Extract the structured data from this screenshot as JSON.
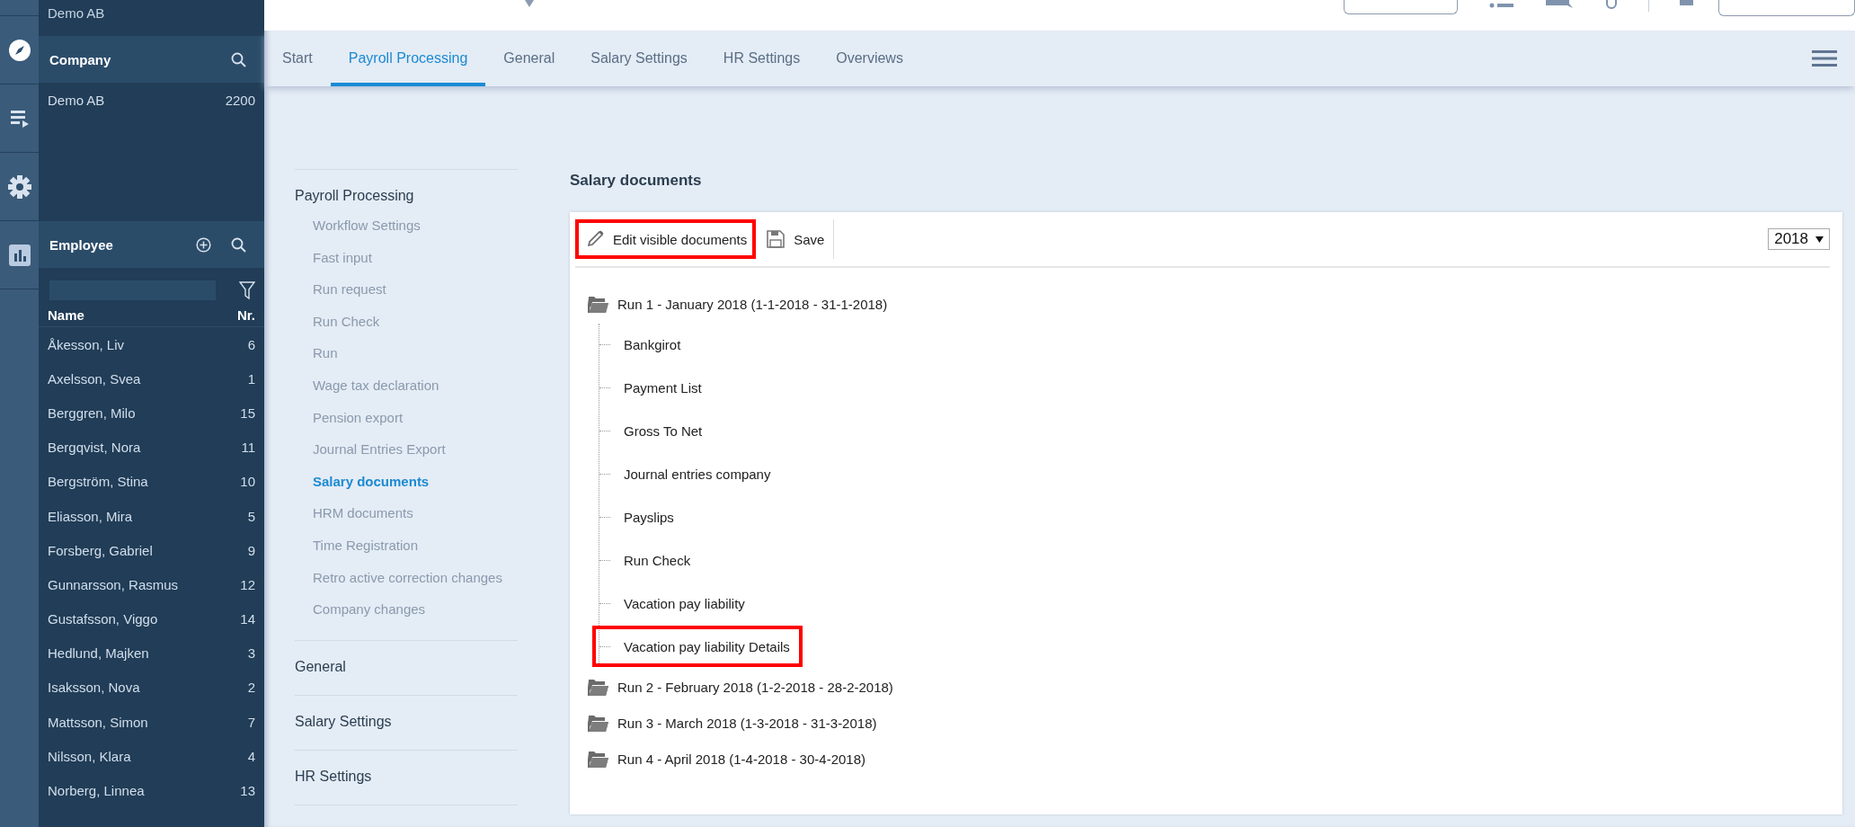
{
  "sidebar": {
    "top_company": "Demo AB",
    "rail": [
      {
        "kind": "compass"
      },
      {
        "kind": "list"
      },
      {
        "kind": "gear"
      },
      {
        "kind": "chart"
      }
    ],
    "company": {
      "title": "Company",
      "rows": [
        {
          "name": "Demo AB",
          "number": "2200"
        }
      ]
    },
    "employee": {
      "title": "Employee",
      "columns": [
        "Name",
        "Nr."
      ],
      "rows": [
        {
          "name": "Åkesson, Liv",
          "number": "6"
        },
        {
          "name": "Axelsson, Svea",
          "number": "1"
        },
        {
          "name": "Berggren, Milo",
          "number": "15"
        },
        {
          "name": "Bergqvist, Nora",
          "number": "11"
        },
        {
          "name": "Bergström, Stina",
          "number": "10"
        },
        {
          "name": "Eliasson, Mira",
          "number": "5"
        },
        {
          "name": "Forsberg, Gabriel",
          "number": "9"
        },
        {
          "name": "Gunnarsson, Rasmus",
          "number": "12"
        },
        {
          "name": "Gustafsson, Viggo",
          "number": "14"
        },
        {
          "name": "Hedlund, Majken",
          "number": "3"
        },
        {
          "name": "Isaksson, Nova",
          "number": "2"
        },
        {
          "name": "Mattsson, Simon",
          "number": "7"
        },
        {
          "name": "Nilsson, Klara",
          "number": "4"
        },
        {
          "name": "Norberg, Linnea",
          "number": "13"
        }
      ]
    }
  },
  "tabs": [
    {
      "label": "Start",
      "selected": false
    },
    {
      "label": "Payroll Processing",
      "selected": true
    },
    {
      "label": "General",
      "selected": false
    },
    {
      "label": "Salary Settings",
      "selected": false
    },
    {
      "label": "HR Settings",
      "selected": false
    },
    {
      "label": "Overviews",
      "selected": false
    }
  ],
  "nav": [
    {
      "title": "Payroll Processing",
      "items": [
        {
          "label": "Workflow Settings",
          "selected": false
        },
        {
          "label": "Fast input",
          "selected": false
        },
        {
          "label": "Run request",
          "selected": false
        },
        {
          "label": "Run Check",
          "selected": false
        },
        {
          "label": "Run",
          "selected": false
        },
        {
          "label": "Wage tax declaration",
          "selected": false
        },
        {
          "label": "Pension export",
          "selected": false
        },
        {
          "label": "Journal Entries Export",
          "selected": false
        },
        {
          "label": "Salary documents",
          "selected": true
        },
        {
          "label": "HRM documents",
          "selected": false
        },
        {
          "label": "Time Registration",
          "selected": false
        },
        {
          "label": "Retro active correction changes",
          "selected": false
        },
        {
          "label": "Company changes",
          "selected": false
        }
      ]
    },
    {
      "title": "General"
    },
    {
      "title": "Salary Settings"
    },
    {
      "title": "HR Settings"
    }
  ],
  "panel": {
    "title": "Salary documents",
    "toolbar": [
      {
        "kind": "edit",
        "label": "Edit visible documents",
        "highlighted": true
      },
      {
        "kind": "save",
        "label": "Save",
        "highlighted": false
      }
    ],
    "year": "2018",
    "tree": [
      {
        "label": "Run 1 - January 2018 (1-1-2018 - 31-1-2018)",
        "children": [
          {
            "label": "Bankgirot",
            "highlighted": false
          },
          {
            "label": "Payment List",
            "highlighted": false
          },
          {
            "label": "Gross To Net",
            "highlighted": false
          },
          {
            "label": "Journal entries company",
            "highlighted": false
          },
          {
            "label": "Payslips",
            "highlighted": false
          },
          {
            "label": "Run Check",
            "highlighted": false
          },
          {
            "label": "Vacation pay liability",
            "highlighted": false
          },
          {
            "label": "Vacation pay liability Details",
            "highlighted": true
          }
        ]
      },
      {
        "label": "Run 2 - February 2018 (1-2-2018 - 28-2-2018)"
      },
      {
        "label": "Run 3 - March 2018 (1-3-2018 - 31-3-2018)"
      },
      {
        "label": "Run 4 - April 2018 (1-4-2018 - 30-4-2018)"
      }
    ]
  }
}
